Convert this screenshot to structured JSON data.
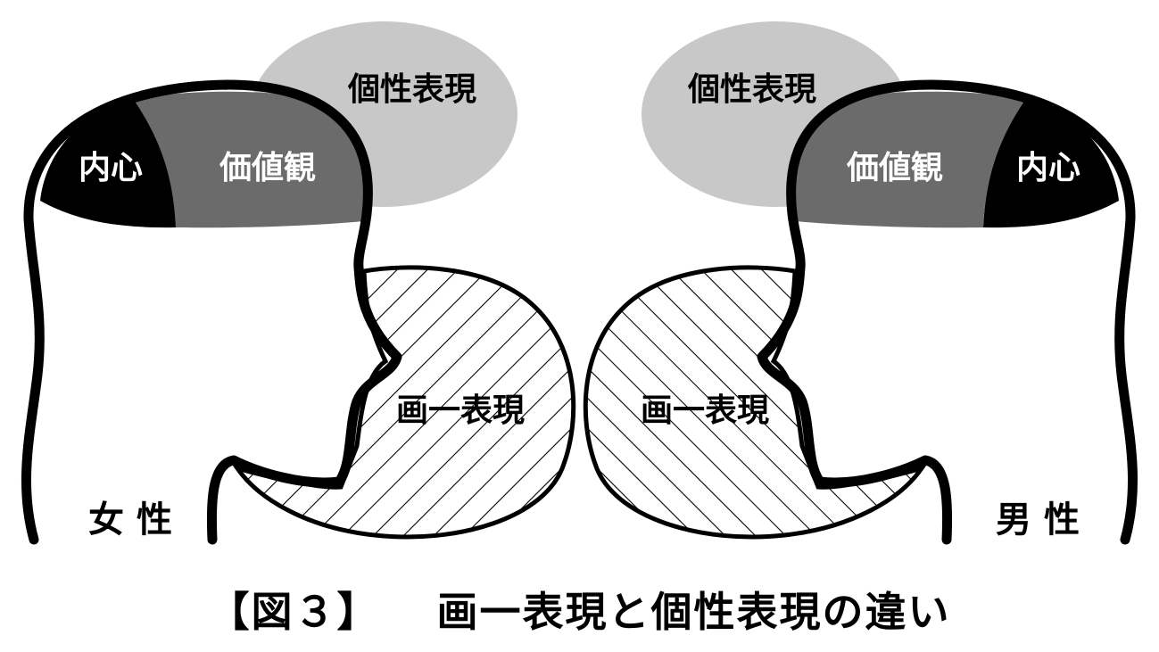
{
  "diagram": {
    "left": {
      "label_inner": "内心",
      "label_values": "価値観",
      "label_individual": "個性表現",
      "label_uniform": "画一表現",
      "label_gender": "女 性"
    },
    "right": {
      "label_inner": "内心",
      "label_values": "価値観",
      "label_individual": "個性表現",
      "label_uniform": "画一表現",
      "label_gender": "男 性"
    },
    "colors": {
      "inner": "#000000",
      "values": "#6b6b6b",
      "individual": "#c8c8c8",
      "outline": "#000000",
      "hatch": "#000000"
    }
  },
  "caption": {
    "figure_number": "【図３】",
    "title": "画一表現と個性表現の違い"
  }
}
